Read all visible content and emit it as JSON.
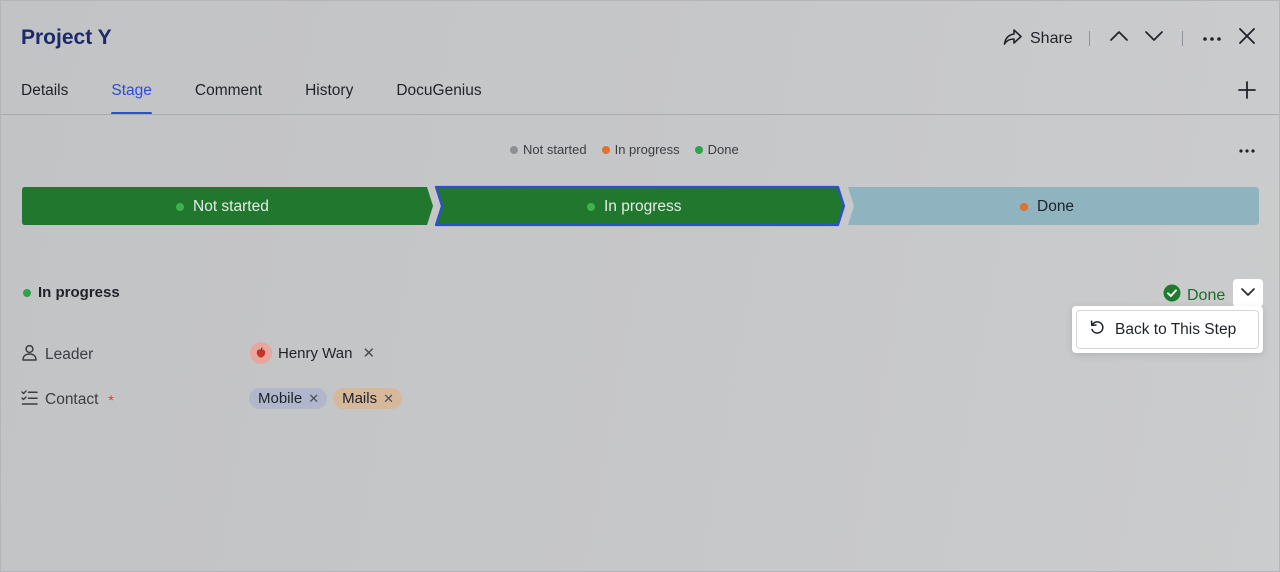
{
  "header": {
    "title": "Project Y",
    "share_label": "Share"
  },
  "tabs": [
    {
      "label": "Details",
      "active": false
    },
    {
      "label": "Stage",
      "active": true
    },
    {
      "label": "Comment",
      "active": false
    },
    {
      "label": "History",
      "active": false
    },
    {
      "label": "DocuGenius",
      "active": false
    }
  ],
  "legend": [
    {
      "label": "Not started",
      "color": "#8c8f94"
    },
    {
      "label": "In progress",
      "color": "#e0722f"
    },
    {
      "label": "Done",
      "color": "#2ea44a"
    }
  ],
  "stages": [
    {
      "label": "Not started",
      "fill": "#22772f",
      "dot": "#3fb24f",
      "text_color": "#e3efe5",
      "selected": false
    },
    {
      "label": "In progress",
      "fill": "#22772f",
      "dot": "#3fb24f",
      "text_color": "#e3efe5",
      "selected": true,
      "outline": "#2d4fd1"
    },
    {
      "label": "Done",
      "fill": "#8fb3bf",
      "dot": "#e0722f",
      "text_color": "#1f2329",
      "selected": false
    }
  ],
  "current": {
    "label": "In progress",
    "dot_color": "#2ea44a",
    "status_label": "Done",
    "status_color": "#1e6b2a"
  },
  "dropdown": {
    "item_label": "Back to This Step"
  },
  "fields": {
    "leader": {
      "label": "Leader",
      "person_name": "Henry Wan"
    },
    "contact": {
      "label": "Contact",
      "required_mark": "*",
      "tags": [
        {
          "label": "Mobile",
          "color": "#b0b7cb"
        },
        {
          "label": "Mails",
          "color": "#d6b99a"
        }
      ]
    }
  },
  "icons": {
    "share": "share-icon",
    "up": "chevron-up-icon",
    "down": "chevron-down-icon",
    "more": "more-icon",
    "close": "close-icon",
    "add": "plus-icon",
    "leader": "person-icon",
    "contact": "checklist-icon",
    "undo": "undo-icon",
    "done": "check-circle-icon"
  }
}
